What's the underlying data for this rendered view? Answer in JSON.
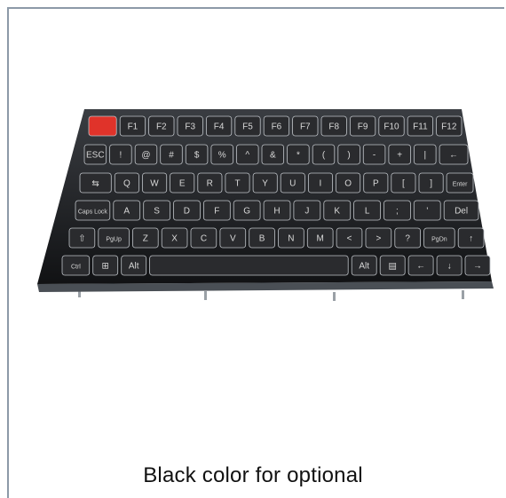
{
  "caption": "Black color for optional",
  "keyboard": {
    "color": "#1a1b1d",
    "key_color": "#2a2b2e",
    "esc_key_color": "#e0332a",
    "legend_color": "#d8d8d8",
    "rows": [
      [
        "",
        "F1",
        "F2",
        "F3",
        "F4",
        "F5",
        "F6",
        "F7",
        "F8",
        "F9",
        "F10",
        "F11",
        "F12"
      ],
      [
        "ESC",
        "!",
        "@",
        "#",
        "$",
        "%",
        "^",
        "&",
        "*",
        "(",
        ")",
        "-",
        "+",
        "|",
        "←"
      ],
      [
        "⇆",
        "Q",
        "W",
        "E",
        "R",
        "T",
        "Y",
        "U",
        "I",
        "O",
        "P",
        "[",
        "]",
        "Enter"
      ],
      [
        "Caps Lock",
        "A",
        "S",
        "D",
        "F",
        "G",
        "H",
        "J",
        "K",
        "L",
        ";",
        "'",
        "Del"
      ],
      [
        "⇧",
        "PgUp",
        "Z",
        "X",
        "C",
        "V",
        "B",
        "N",
        "M",
        "<",
        ">",
        "?",
        "PgDn",
        "↑"
      ],
      [
        "Ctrl",
        "⊞",
        "Alt",
        "",
        "Alt",
        "▤",
        "←",
        "↓",
        "→"
      ]
    ]
  }
}
